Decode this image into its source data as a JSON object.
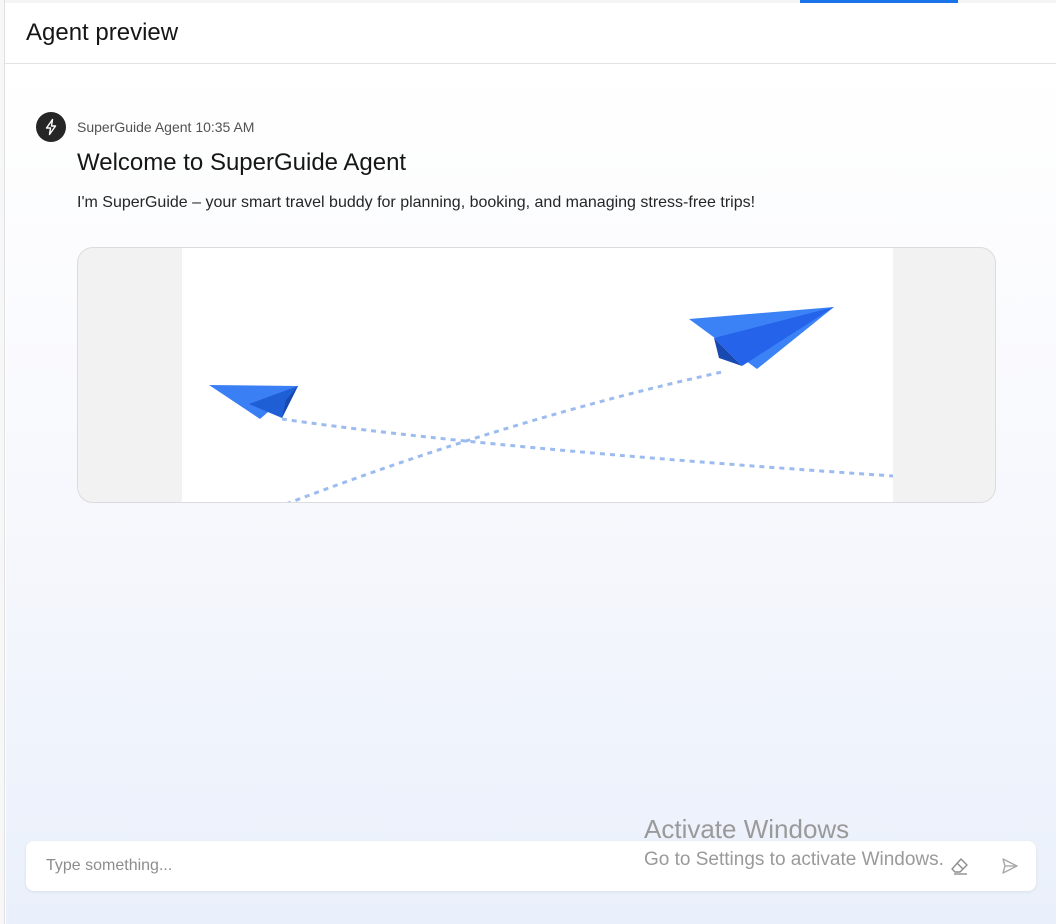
{
  "header": {
    "title": "Agent preview"
  },
  "message": {
    "sender": "SuperGuide Agent",
    "time": "10:35 AM",
    "title": "Welcome to SuperGuide Agent",
    "body": "I'm SuperGuide – your smart travel buddy for planning, booking, and managing stress-free trips!",
    "avatar_icon": "lightning-bolt-icon"
  },
  "image": {
    "icon": "paper-planes-illustration",
    "plane_color": "#2f6ff0"
  },
  "input": {
    "placeholder": "Type something...",
    "value": ""
  },
  "actions": {
    "clear_icon": "eraser-icon",
    "send_icon": "send-icon"
  },
  "watermark": {
    "title": "Activate Windows",
    "subtitle": "Go to Settings to activate Windows."
  },
  "colors": {
    "accent": "#1a73e8",
    "avatar_bg": "#262626"
  }
}
